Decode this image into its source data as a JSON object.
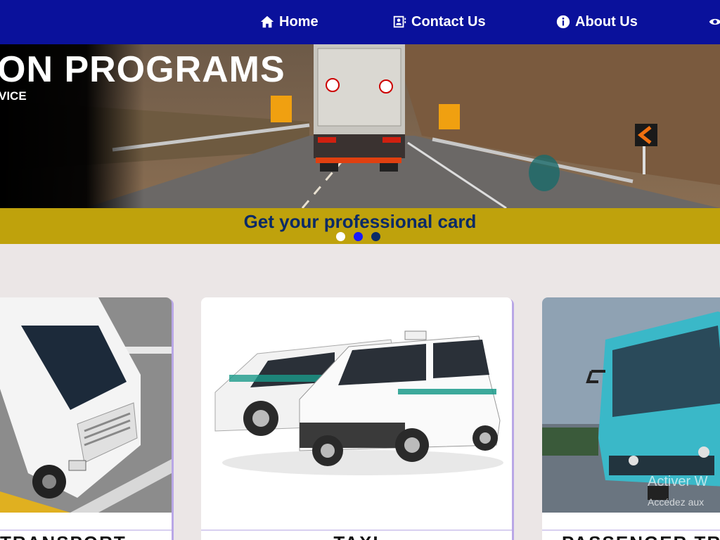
{
  "nav": {
    "items": [
      {
        "label": "Home",
        "icon": "home-icon"
      },
      {
        "label": "Contact Us",
        "icon": "contact-card-icon"
      },
      {
        "label": "About Us",
        "icon": "info-icon"
      }
    ]
  },
  "hero": {
    "title": "ON PROGRAMS",
    "subtitle": "VICE"
  },
  "banner": {
    "text": "Get your professional card",
    "dots": [
      {
        "color": "#ffffff",
        "active": false
      },
      {
        "color": "#1a1aff",
        "active": true
      },
      {
        "color": "#0a2a66",
        "active": false
      }
    ]
  },
  "cards": [
    {
      "label": "TRANSPORT",
      "image": "truck-image"
    },
    {
      "label": "TAXI",
      "image": "taxi-image"
    },
    {
      "label": "PASSENGER TR",
      "image": "bus-image"
    }
  ],
  "watermark": {
    "line1": "Activer W",
    "line2": "Accédez aux"
  },
  "colors": {
    "nav_bg": "#0a119b",
    "banner_bg": "#bfa20c",
    "banner_text": "#0a2a66",
    "page_bg": "#ebe6e6"
  }
}
